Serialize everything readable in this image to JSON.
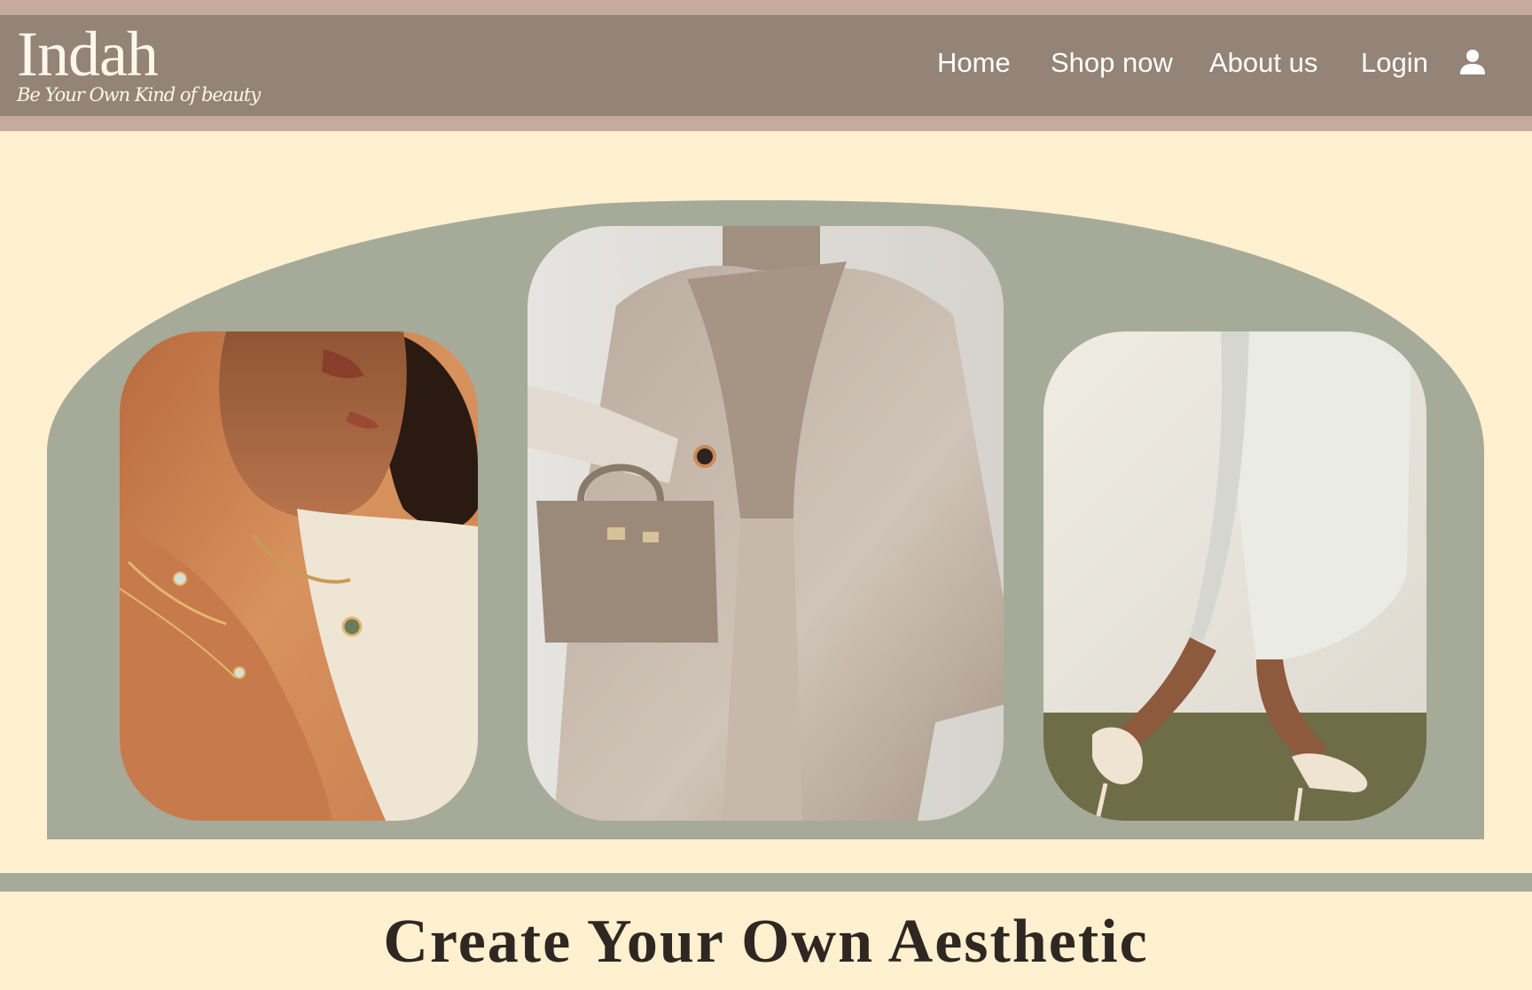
{
  "brand": {
    "name": "Indah",
    "tagline": "Be Your Own Kind of beauty"
  },
  "nav": {
    "items": [
      {
        "label": "Home"
      },
      {
        "label": "Shop now"
      },
      {
        "label": "About us"
      },
      {
        "label": "Login"
      }
    ],
    "account_icon": "user-icon"
  },
  "hero": {
    "images": [
      {
        "subject": "jewelry-necklaces"
      },
      {
        "subject": "beige-coat-with-handbag"
      },
      {
        "subject": "white-heels-and-dress"
      }
    ]
  },
  "headline": {
    "text": "Create Your Own Aesthetic"
  },
  "colors": {
    "top_strip": "#c6aa9b",
    "navbar": "#938477",
    "page_background": "#fff0cf",
    "hero_arch": "#a6aa99",
    "headline_text": "#2e2722"
  }
}
